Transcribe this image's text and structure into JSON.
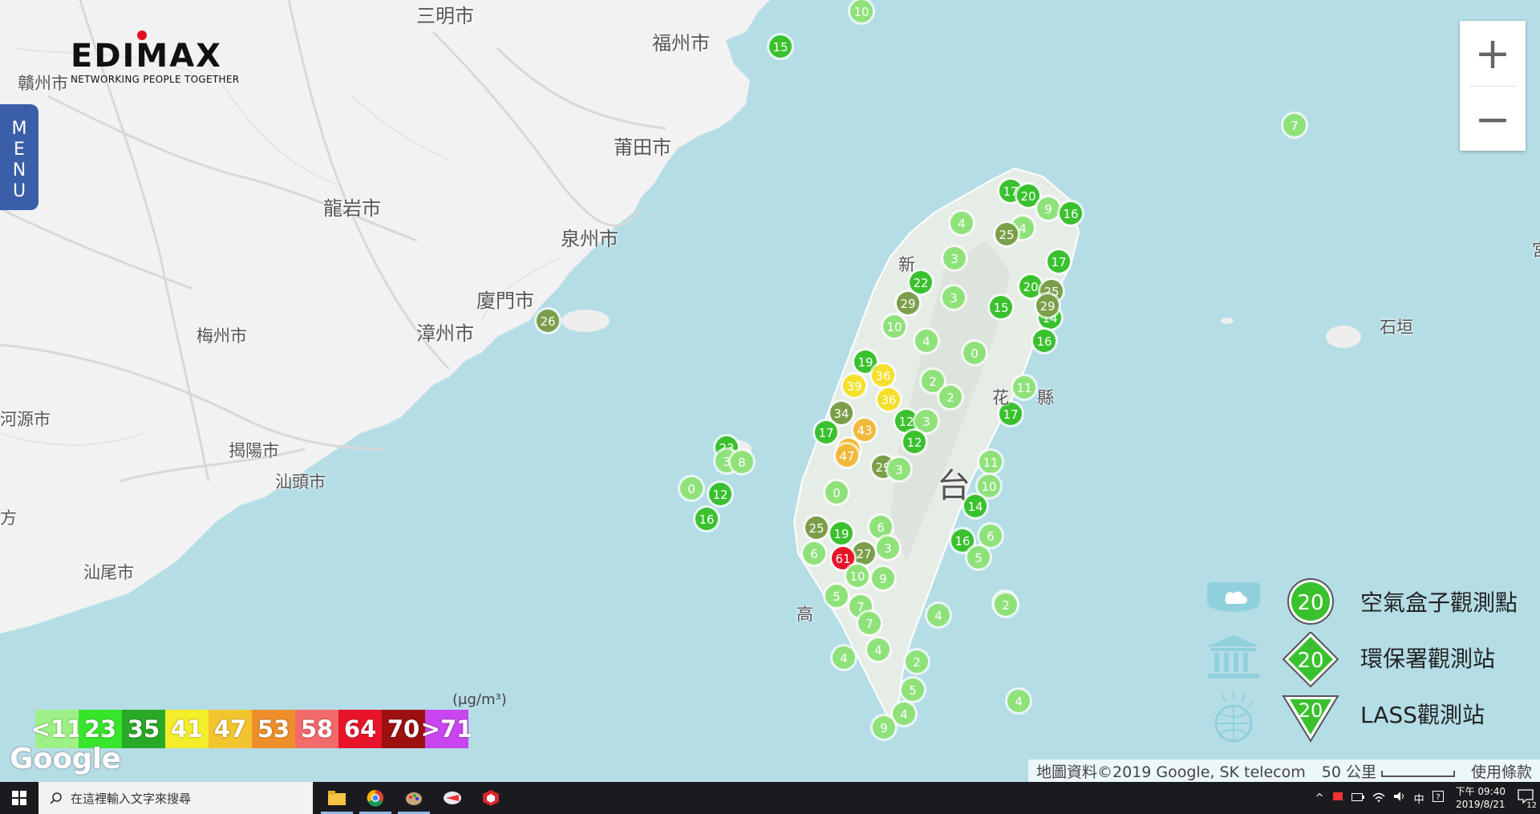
{
  "brand": {
    "logo_text": "EDIMAX",
    "tagline": "NETWORKING PEOPLE TOGETHER"
  },
  "menu": {
    "letters": [
      "M",
      "E",
      "N",
      "U"
    ]
  },
  "zoom": {
    "in_label": "+",
    "out_label": "−"
  },
  "cities": [
    {
      "name": "三明市"
    },
    {
      "name": "福州市"
    },
    {
      "name": "贛州市"
    },
    {
      "name": "莆田市"
    },
    {
      "name": "龍岩市"
    },
    {
      "name": "泉州市"
    },
    {
      "name": "廈門市"
    },
    {
      "name": "漳州市"
    },
    {
      "name": "梅州市"
    },
    {
      "name": "河源市"
    },
    {
      "name": "揭陽市"
    },
    {
      "name": "汕頭市"
    },
    {
      "name": "汕尾市"
    },
    {
      "name": "石垣"
    },
    {
      "name": "台"
    },
    {
      "name": "花"
    },
    {
      "name": "縣"
    },
    {
      "name": "新"
    },
    {
      "name": "高"
    },
    {
      "name": "宮"
    },
    {
      "name": "方"
    }
  ],
  "pm_scale": {
    "unit": "(μg/m³)",
    "bins": [
      {
        "label": "<11",
        "color": "#9cf085"
      },
      {
        "label": "23",
        "color": "#36e52c"
      },
      {
        "label": "35",
        "color": "#2aa828"
      },
      {
        "label": "41",
        "color": "#f4ee2a"
      },
      {
        "label": "47",
        "color": "#f2c42e"
      },
      {
        "label": "53",
        "color": "#ee8e2a"
      },
      {
        "label": "58",
        "color": "#f26a6a"
      },
      {
        "label": "64",
        "color": "#e8142a"
      },
      {
        "label": "70",
        "color": "#9c1010"
      },
      {
        "label": ">71",
        "color": "#c845ef"
      }
    ]
  },
  "legend": {
    "items": [
      {
        "label": "空氣盒子觀測點",
        "badge": "20",
        "shape": "circle",
        "icon": "cloud-box-icon"
      },
      {
        "label": "環保署觀測站",
        "badge": "20",
        "shape": "diamond",
        "icon": "government-building-icon"
      },
      {
        "label": "LASS觀測站",
        "badge": "20",
        "shape": "triangle-down",
        "icon": "globe-sensor-icon"
      }
    ]
  },
  "map_markers": [
    {
      "value": "10"
    },
    {
      "value": "15"
    },
    {
      "value": "7"
    },
    {
      "value": "26"
    },
    {
      "value": "23"
    },
    {
      "value": "3"
    },
    {
      "value": "8"
    },
    {
      "value": "0"
    },
    {
      "value": "12"
    },
    {
      "value": "16"
    },
    {
      "value": "17"
    },
    {
      "value": "20"
    },
    {
      "value": "9"
    },
    {
      "value": "16"
    },
    {
      "value": "4"
    },
    {
      "value": "25"
    },
    {
      "value": "4"
    },
    {
      "value": "29"
    },
    {
      "value": "3"
    },
    {
      "value": "17"
    },
    {
      "value": "22"
    },
    {
      "value": "3"
    },
    {
      "value": "20"
    },
    {
      "value": "25"
    },
    {
      "value": "15"
    },
    {
      "value": "14"
    },
    {
      "value": "29"
    },
    {
      "value": "10"
    },
    {
      "value": "4"
    },
    {
      "value": "16"
    },
    {
      "value": "19"
    },
    {
      "value": "36"
    },
    {
      "value": "0"
    },
    {
      "value": "39"
    },
    {
      "value": "36"
    },
    {
      "value": "2"
    },
    {
      "value": "2"
    },
    {
      "value": "11"
    },
    {
      "value": "34"
    },
    {
      "value": "43"
    },
    {
      "value": "12"
    },
    {
      "value": "3"
    },
    {
      "value": "17"
    },
    {
      "value": "17"
    },
    {
      "value": "43"
    },
    {
      "value": "12"
    },
    {
      "value": "47"
    },
    {
      "value": "29"
    },
    {
      "value": "11"
    },
    {
      "value": "3"
    },
    {
      "value": "10"
    },
    {
      "value": "0"
    },
    {
      "value": "14"
    },
    {
      "value": "25"
    },
    {
      "value": "19"
    },
    {
      "value": "6"
    },
    {
      "value": "16"
    },
    {
      "value": "6"
    },
    {
      "value": "27"
    },
    {
      "value": "3"
    },
    {
      "value": "6"
    },
    {
      "value": "61"
    },
    {
      "value": "5"
    },
    {
      "value": "10"
    },
    {
      "value": "9"
    },
    {
      "value": "5"
    },
    {
      "value": "7"
    },
    {
      "value": "7"
    },
    {
      "value": "2"
    },
    {
      "value": "4"
    },
    {
      "value": "4"
    },
    {
      "value": "4"
    },
    {
      "value": "2"
    },
    {
      "value": "2"
    },
    {
      "value": "5"
    },
    {
      "value": "4"
    },
    {
      "value": "4"
    },
    {
      "value": "9"
    }
  ],
  "attribution": {
    "map_data": "地圖資料©2019 Google, SK telecom",
    "scale": "50 公里",
    "terms": "使用條款",
    "google": "Google"
  },
  "taskbar": {
    "search_placeholder": "在這裡輸入文字來搜尋",
    "time": "下午 09:40",
    "date": "2019/8/21",
    "ime": "中",
    "notifications": "12"
  }
}
